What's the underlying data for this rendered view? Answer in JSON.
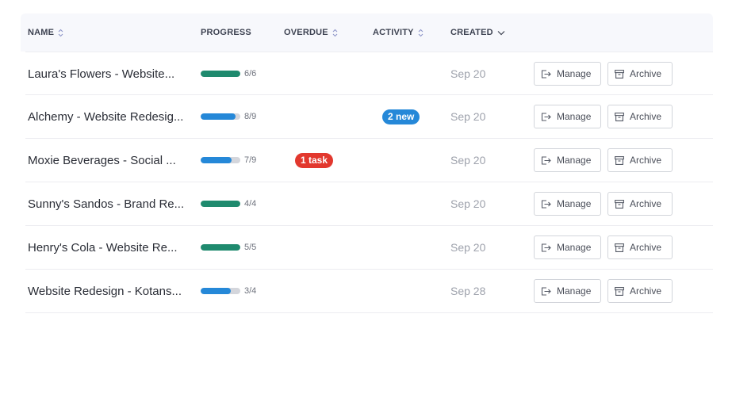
{
  "table": {
    "headers": {
      "name": "NAME",
      "progress": "PROGRESS",
      "overdue": "OVERDUE",
      "activity": "ACTIVITY",
      "created": "CREATED"
    },
    "rows": [
      {
        "name": "Laura's Flowers - Website...",
        "progress_done": 6,
        "progress_total": 6,
        "progress_label": "6/6",
        "overdue": "",
        "activity": "",
        "created": "Sep 20",
        "manage": "Manage",
        "archive": "Archive"
      },
      {
        "name": "Alchemy - Website Redesig...",
        "progress_done": 8,
        "progress_total": 9,
        "progress_label": "8/9",
        "overdue": "",
        "activity": "2 new",
        "created": "Sep 20",
        "manage": "Manage",
        "archive": "Archive"
      },
      {
        "name": "Moxie Beverages - Social ...",
        "progress_done": 7,
        "progress_total": 9,
        "progress_label": "7/9",
        "overdue": "1 task",
        "activity": "",
        "created": "Sep 20",
        "manage": "Manage",
        "archive": "Archive"
      },
      {
        "name": "Sunny's Sandos - Brand Re...",
        "progress_done": 4,
        "progress_total": 4,
        "progress_label": "4/4",
        "overdue": "",
        "activity": "",
        "created": "Sep 20",
        "manage": "Manage",
        "archive": "Archive"
      },
      {
        "name": "Henry's Cola - Website Re...",
        "progress_done": 5,
        "progress_total": 5,
        "progress_label": "5/5",
        "overdue": "",
        "activity": "",
        "created": "Sep 20",
        "manage": "Manage",
        "archive": "Archive"
      },
      {
        "name": "Website Redesign - Kotans...",
        "progress_done": 3,
        "progress_total": 4,
        "progress_label": "3/4",
        "overdue": "",
        "activity": "",
        "created": "Sep 28",
        "manage": "Manage",
        "archive": "Archive"
      }
    ]
  },
  "colors": {
    "progress_complete": "#1f8a6e",
    "progress_partial": "#2588d8",
    "overdue_badge": "#e2382e",
    "activity_badge": "#2588d8"
  },
  "icons": {
    "sort": "sort-updown-icon",
    "sort_active": "chevron-down-icon",
    "manage": "exit-arrow-icon",
    "archive": "archive-box-icon"
  }
}
